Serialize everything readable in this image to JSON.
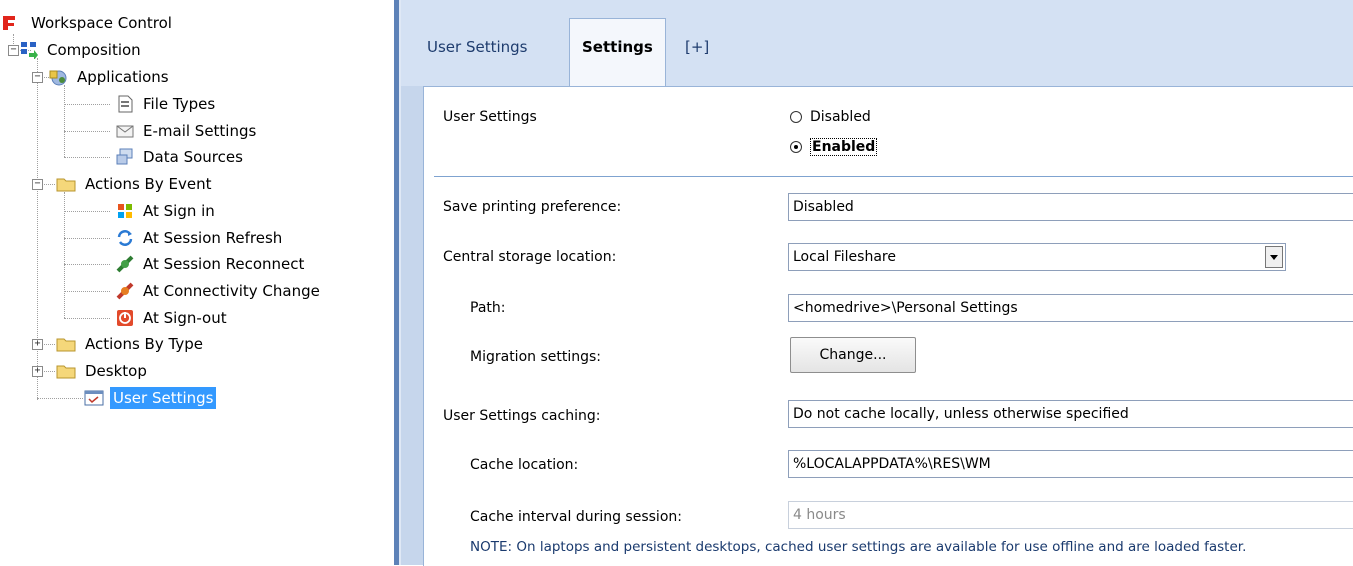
{
  "tree": {
    "root": "Workspace Control",
    "composition": "Composition",
    "applications": "Applications",
    "file_types": "File Types",
    "email_settings": "E-mail Settings",
    "data_sources": "Data Sources",
    "actions_by_event": "Actions By Event",
    "at_sign_in": "At Sign in",
    "at_session_refresh": "At Session Refresh",
    "at_session_reconnect": "At Session Reconnect",
    "at_connectivity_change": "At Connectivity Change",
    "at_sign_out": "At Sign-out",
    "actions_by_type": "Actions By Type",
    "desktop": "Desktop",
    "user_settings": "User Settings"
  },
  "tabs": [
    "User Settings",
    "Settings",
    "[+]"
  ],
  "form": {
    "user_settings_label": "User Settings",
    "radio_disabled": "Disabled",
    "radio_enabled": "Enabled",
    "save_printing_label": "Save printing preference:",
    "save_printing_value": "Disabled",
    "central_storage_label": "Central storage location:",
    "central_storage_value": "Local Fileshare",
    "path_label": "Path:",
    "path_value": "<homedrive>\\Personal Settings",
    "migration_label": "Migration settings:",
    "change_button": "Change...",
    "caching_label": "User Settings caching:",
    "caching_value": "Do not cache locally, unless otherwise specified",
    "cache_location_label": "Cache location:",
    "cache_location_value": "%LOCALAPPDATA%\\RES\\WM",
    "cache_interval_label": "Cache interval during session:",
    "cache_interval_value": "4 hours",
    "note": "NOTE: On laptops and persistent desktops, cached user settings are available for use offline and are loaded faster."
  },
  "colors": {
    "selection": "#3399ff",
    "panel_bg": "#c6d6ec",
    "tab_bg": "#d4e1f3"
  }
}
